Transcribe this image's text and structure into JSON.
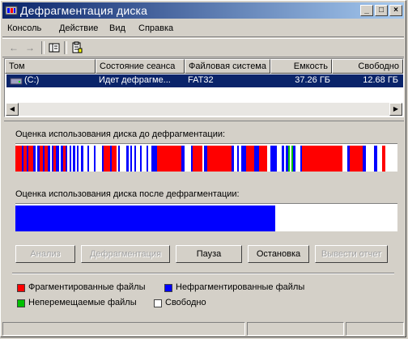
{
  "window": {
    "title": "Дефрагментация диска",
    "minimize_glyph": "_",
    "maximize_glyph": "□",
    "close_glyph": "×"
  },
  "menu": [
    "Консоль",
    "Действие",
    "Вид",
    "Справка"
  ],
  "toolbar": {
    "back_icon": "arrow-left-icon",
    "forward_icon": "arrow-right-icon",
    "back_glyph": "←",
    "forward_glyph": "→"
  },
  "volumes": {
    "columns": [
      "Том",
      "Состояние сеанса",
      "Файловая система",
      "Емкость",
      "Свободно"
    ],
    "rows": [
      {
        "volume": "(C:)",
        "status": "Идет дефрагме...",
        "fs": "FAT32",
        "capacity": "37.26 ГБ",
        "free": "12.68 ГБ"
      }
    ]
  },
  "analysis": {
    "before_label": "Оценка использования диска до дефрагментации:",
    "after_label": "Оценка использования диска после дефрагментации:",
    "after_fill_fraction": 0.68
  },
  "buttons": {
    "analyze": "Анализ",
    "defragment": "Дефрагментация",
    "pause": "Пауза",
    "stop": "Остановка",
    "report": "Вывести отчет"
  },
  "legend": {
    "fragmented": "Фрагментированные файлы",
    "contiguous": "Нефрагментированные файлы",
    "unmovable": "Неперемещаемые файлы",
    "free": "Свободно"
  },
  "colors": {
    "fragmented": "#ff0000",
    "contiguous": "#0000ff",
    "unmovable": "#00c000",
    "free": "#ffffff",
    "title_start": "#0a246a",
    "title_end": "#a6caf0"
  }
}
